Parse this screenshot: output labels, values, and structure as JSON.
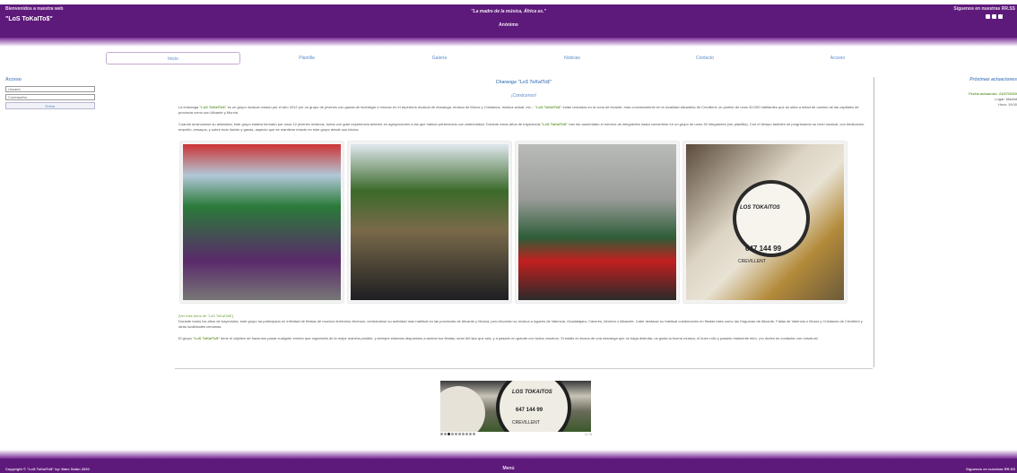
{
  "header": {
    "welcome": "Bienvenidos a nuestra web",
    "site_name": "\"LoS ToKaITo$\"",
    "quote": "\"La madre de la música, África es.\"",
    "quote_author": "Anónimo",
    "follow": "Síguenos en nuestras RR.SS",
    "social_icons": [
      "facebook-icon",
      "instagram-icon",
      "youtube-icon"
    ],
    "accent_color": "#5e1a7a"
  },
  "nav": {
    "items": [
      "Inicio",
      "Plantilla",
      "Galería",
      "Noticias",
      "Contacto",
      "Acceso"
    ],
    "active": "Inicio"
  },
  "login": {
    "title": "Acceso",
    "user_placeholder": "Usuario",
    "password_placeholder": "Contraseña",
    "button": "Entrar"
  },
  "sidebar": {
    "title": "Próximas actuaciones",
    "date": "Fecha actuación: 21/07/2020",
    "place": "Lugar: Madrid",
    "time": "Hora: 19:00"
  },
  "main": {
    "title": "Charanga \"LoS ToKaITo$\"",
    "subtitle": "¡Conócenos!",
    "p1_a": "La charanga ",
    "p1_b": "\"LoS ToKaITo$\"",
    "p1_c": " es un grupo musical creado por el año 2012 por un grupo de jóvenes con ganas de investigar e innovar en el repertorio musical de charanga, música de Moros y Cristianos, música actual, etc... ",
    "p1_d": "\"LoS ToKaITo$\"",
    "p1_e": " están ubicados en la zona de levante, mas concretamente en la localidad alicantina de Crevillent, un pueblo de unos 30.000 habitantes que se sitúa a mitad de camino de las capitales de provincia como son Alicante y Murcia.",
    "p2_a": "Cuando arrancamos su andadura, este grupo estaba formado por unos 12 jóvenes músicos, todos con gran experiencia anterior en agrupaciones a las que habían pertenecido con anterioridad. Durante estos años de trayectoria,",
    "p2_b": "\"LoS ToKaITo$\"",
    "p2_c": " han ido aumentado el número de integrantes hasta convertirse en un grupo de unos 30 integrantes (ver plantilla). Con el tiempo también se progresando su nivel musical, con dedicación, empeño, ensayos, y sobre todo ilusión y ganas, aspecto que se mantiene intacto en este grupo desde sus inicios.",
    "photo_label": "[Ver mas fotos de \"LoS ToKaITo$\"]",
    "p3": "Durante todos los años de trayectoria, este grupo ha participado en infinidad de fiestas de muchos territorios diversos, centrándose su actividad mas habitual en las provincias de Alicante y Murcia, pero llevando su música a lugares de Valencia, Guadalajara, Cáceres, Almería o Albacete. Cabe destacar su habitual colaboración en fiestas tales como las Hogueras de Alicante, Fallas de Valencia o Moros y Cristianos de Crevillent y otras localidades cercanas.",
    "p4_a": "El grupo ",
    "p4_b": "\"LoS ToKaITo$\"",
    "p4_c": " tiene el objetivo de hacernos pasar cualquier evento que organicéis de la mejor manera posible, y siempre estamos dispuestos a animar tus fiestas, sean del tipo que sea, y a pasarlo en grande con todos vosotros. Si estáis en busca de una charanga que os haga disfrutar, os gusta la buena música, el buen rollo y pasarlo realmente bien, ¡no dudes en contactar con nosotros!",
    "drum_text": "LOS TOKAITOS",
    "drum_number": "647 144 99",
    "drum_city": "CREVILLENT"
  },
  "slider": {
    "total_dots": 10,
    "active_dot": 2,
    "pager": "1 / 3"
  },
  "footer": {
    "copyright": "Copyright © \"LoS ToKaITo$\" by: Marc Solán 2020",
    "center": "Menú",
    "right": "Síguenos en nuestras RR.SS"
  }
}
